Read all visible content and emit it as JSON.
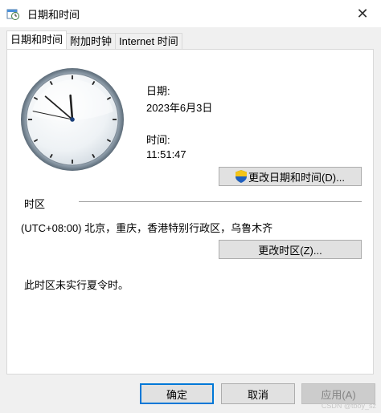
{
  "window": {
    "title": "日期和时间",
    "close_glyph": "✕"
  },
  "tabs": [
    {
      "label": "日期和时间",
      "active": true
    },
    {
      "label": "附加时钟",
      "active": false
    },
    {
      "label": "Internet 时间",
      "active": false
    }
  ],
  "datetime": {
    "date_label": "日期:",
    "date_value": "2023年6月3日",
    "time_label": "时间:",
    "time_value": "11:51:47",
    "change_button": "更改日期和时间(D)..."
  },
  "timezone": {
    "section_label": "时区",
    "value": "(UTC+08:00) 北京，重庆，香港特别行政区，乌鲁木齐",
    "change_button": "更改时区(Z)...",
    "dst_note": "此时区未实行夏令时。"
  },
  "footer": {
    "ok": "确定",
    "cancel": "取消",
    "apply": "应用(A)"
  },
  "watermark": "CSDN @tboy_sz",
  "icons": {
    "app": "calendar-clock-icon",
    "shield": "uac-shield-icon",
    "close": "close-icon"
  }
}
